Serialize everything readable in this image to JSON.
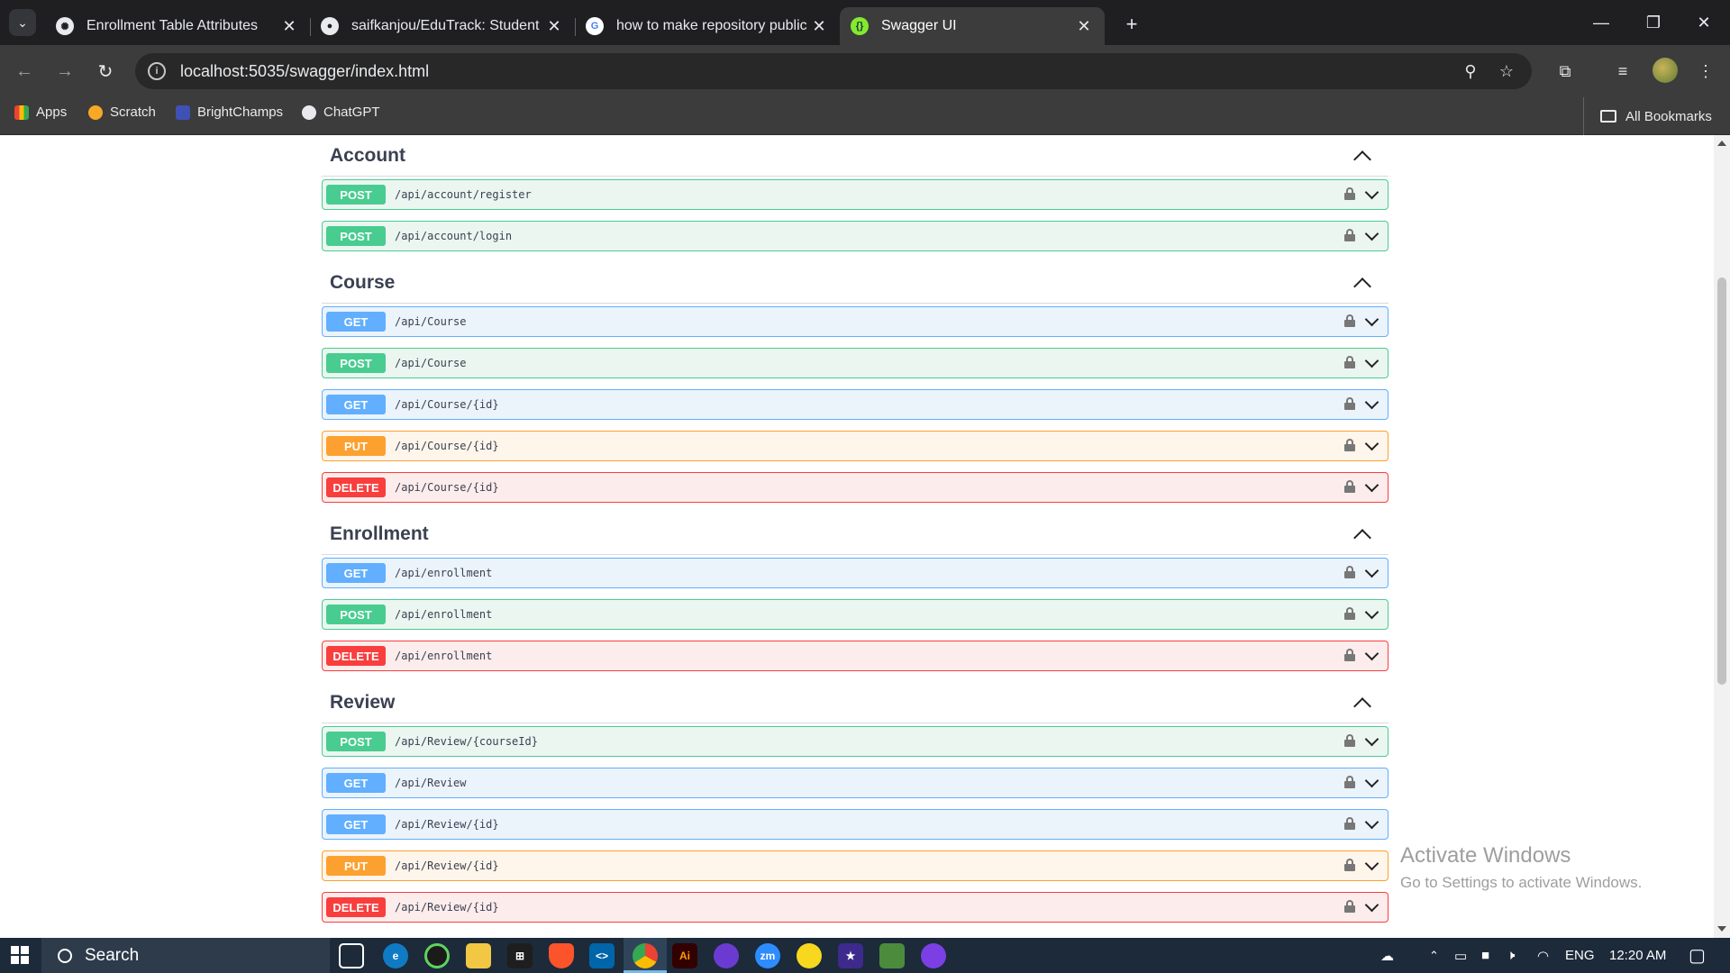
{
  "browser": {
    "tabs": [
      {
        "title": "Enrollment Table Attributes",
        "favicon": "openai-icon",
        "active": false
      },
      {
        "title": "saifkanjou/EduTrack: Student En",
        "favicon": "github-icon",
        "active": false
      },
      {
        "title": "how to make repository public",
        "favicon": "google-icon",
        "active": false
      },
      {
        "title": "Swagger UI",
        "favicon": "swagger-icon",
        "active": true
      }
    ],
    "url": "localhost:5035/swagger/index.html",
    "bookmarks": [
      "Apps",
      "Scratch",
      "BrightChamps",
      "ChatGPT"
    ],
    "all_bookmarks": "All Bookmarks"
  },
  "swagger": {
    "groups": [
      {
        "name": "Account",
        "ops": [
          {
            "method": "POST",
            "path": "/api/account/register"
          },
          {
            "method": "POST",
            "path": "/api/account/login"
          }
        ]
      },
      {
        "name": "Course",
        "ops": [
          {
            "method": "GET",
            "path": "/api/Course"
          },
          {
            "method": "POST",
            "path": "/api/Course"
          },
          {
            "method": "GET",
            "path": "/api/Course/{id}"
          },
          {
            "method": "PUT",
            "path": "/api/Course/{id}"
          },
          {
            "method": "DELETE",
            "path": "/api/Course/{id}"
          }
        ]
      },
      {
        "name": "Enrollment",
        "ops": [
          {
            "method": "GET",
            "path": "/api/enrollment"
          },
          {
            "method": "POST",
            "path": "/api/enrollment"
          },
          {
            "method": "DELETE",
            "path": "/api/enrollment"
          }
        ]
      },
      {
        "name": "Review",
        "ops": [
          {
            "method": "POST",
            "path": "/api/Review/{courseId}"
          },
          {
            "method": "GET",
            "path": "/api/Review"
          },
          {
            "method": "GET",
            "path": "/api/Review/{id}"
          },
          {
            "method": "PUT",
            "path": "/api/Review/{id}"
          },
          {
            "method": "DELETE",
            "path": "/api/Review/{id}"
          }
        ]
      }
    ]
  },
  "watermark": {
    "line1": "Activate Windows",
    "line2": "Go to Settings to activate Windows."
  },
  "taskbar": {
    "search_label": "Search",
    "language": "ENG",
    "time": "12:20 AM"
  },
  "colors": {
    "post": "#49cc90",
    "get": "#61affe",
    "put": "#fca130",
    "delete": "#f93e3e"
  }
}
